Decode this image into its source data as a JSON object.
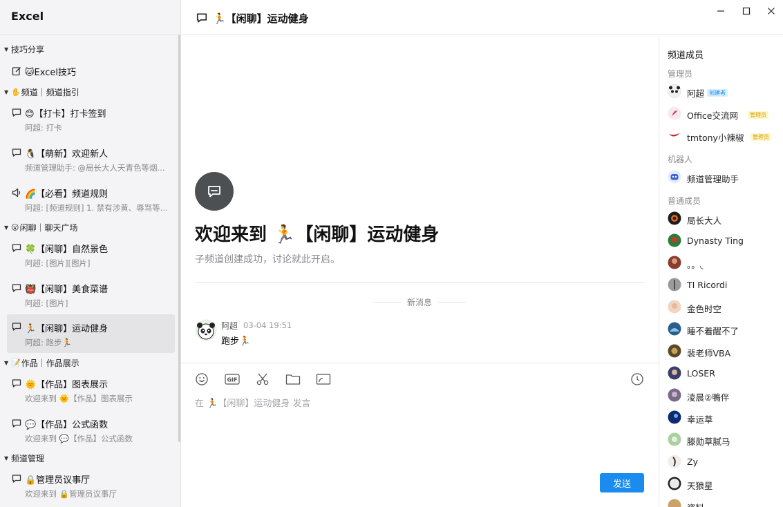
{
  "app": {
    "title": "Excel"
  },
  "window_controls": {
    "minimize": "—",
    "maximize": "☐",
    "close": "✕"
  },
  "sidebar": {
    "sections": [
      {
        "label": "技巧分享",
        "emoji": ""
      },
      {
        "label": "频道｜频道指引",
        "emoji": "✋"
      },
      {
        "label": "闲聊｜聊天广场",
        "emoji": "😮"
      },
      {
        "label": "作品｜作品展示",
        "emoji": "📝"
      },
      {
        "label": "频道管理",
        "emoji": ""
      }
    ],
    "channels": [
      {
        "title": "🐱Excel技巧",
        "subtitle": ""
      },
      {
        "title": "😊【打卡】打卡签到",
        "subtitle": "阿超: 打卡"
      },
      {
        "title": "🐧【萌新】欢迎新人",
        "subtitle": "频道管理助手: @局长大人天青色等烟..."
      },
      {
        "title": "🌈【必看】频道规则",
        "subtitle": "阿超: [频道规则] 1. 禁有涉黄、辱骂等..."
      },
      {
        "title": "🍀【闲聊】自然景色",
        "subtitle": "阿超: [图片][图片]"
      },
      {
        "title": "👹【闲聊】美食菜谱",
        "subtitle": "阿超: [图片]"
      },
      {
        "title": "🏃【闲聊】运动健身",
        "subtitle": "阿超: 跑步🏃"
      },
      {
        "title": "🌞【作品】图表展示",
        "subtitle": "欢迎来到 🌞【作品】图表展示"
      },
      {
        "title": "💬【作品】公式函数",
        "subtitle": "欢迎来到 💬【作品】公式函数"
      },
      {
        "title": "🔒管理员议事厅",
        "subtitle": "欢迎来到 🔒管理员议事厅"
      }
    ]
  },
  "header": {
    "title": "🏃【闲聊】运动健身"
  },
  "welcome": {
    "title": "欢迎来到 🏃【闲聊】运动健身",
    "subtitle": "子频道创建成功，讨论就此开启。"
  },
  "divider": {
    "new_messages": "新消息"
  },
  "message": {
    "author": "阿超",
    "time": "03-04 19:51",
    "text": "跑步🏃"
  },
  "composer": {
    "placeholder": "在 🏃【闲聊】运动健身 发言",
    "send_label": "发送",
    "gif_label": "GIF"
  },
  "members": {
    "title": "频道成员",
    "groups": [
      {
        "label": "管理员",
        "items": [
          {
            "name": "阿超",
            "badge": "创建者"
          },
          {
            "name": "Office交流网",
            "badge": "管理员"
          },
          {
            "name": "tmtony小辣椒",
            "badge": "管理员"
          }
        ]
      },
      {
        "label": "机器人",
        "items": [
          {
            "name": "频道管理助手",
            "badge": ""
          }
        ]
      },
      {
        "label": "普通成员",
        "items": [
          {
            "name": "局长大人",
            "badge": ""
          },
          {
            "name": "Dynasty Ting",
            "badge": ""
          },
          {
            "name": "。。◟",
            "badge": ""
          },
          {
            "name": "TI Ricordi",
            "badge": ""
          },
          {
            "name": "金色时空",
            "badge": ""
          },
          {
            "name": "睡不着醒不了",
            "badge": ""
          },
          {
            "name": "裴老师VBA",
            "badge": ""
          },
          {
            "name": "LOSER",
            "badge": ""
          },
          {
            "name": "淩晨②鴨伴",
            "badge": ""
          },
          {
            "name": "幸运草",
            "badge": ""
          },
          {
            "name": "滕勋草腻马",
            "badge": ""
          },
          {
            "name": "Zy",
            "badge": ""
          },
          {
            "name": "天狼星",
            "badge": ""
          },
          {
            "name": "资料",
            "badge": ""
          }
        ]
      }
    ]
  }
}
